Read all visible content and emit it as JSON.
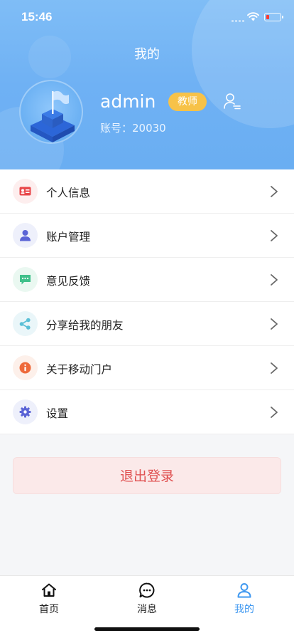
{
  "status_bar": {
    "time": "15:46"
  },
  "header": {
    "title": "我的",
    "username": "admin",
    "role": "教师",
    "account_label": "账号：20030"
  },
  "menu": {
    "items": [
      {
        "label": "个人信息",
        "icon": "id-card-icon",
        "color": "#e8474a"
      },
      {
        "label": "账户管理",
        "icon": "user-icon",
        "color": "#5b64d6"
      },
      {
        "label": "意见反馈",
        "icon": "message-icon",
        "color": "#3fc08a"
      },
      {
        "label": "分享给我的朋友",
        "icon": "share-icon",
        "color": "#5bbfd6"
      },
      {
        "label": "关于移动门户",
        "icon": "info-icon",
        "color": "#ee6a3b"
      },
      {
        "label": "设置",
        "icon": "gear-icon",
        "color": "#5b64d6"
      }
    ]
  },
  "logout": {
    "label": "退出登录"
  },
  "tabbar": {
    "items": [
      {
        "label": "首页",
        "icon": "home-icon",
        "active": false
      },
      {
        "label": "消息",
        "icon": "chat-icon",
        "active": false
      },
      {
        "label": "我的",
        "icon": "profile-icon",
        "active": true
      }
    ]
  },
  "colors": {
    "accent": "#3f98f0",
    "header": "#6fb1f4",
    "badge": "#f7c248",
    "logout_text": "#e05252"
  }
}
